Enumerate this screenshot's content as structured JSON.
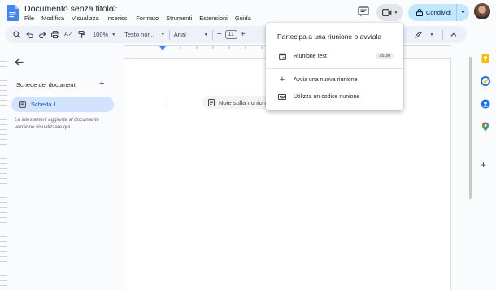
{
  "header": {
    "doc_title": "Documento senza titolo",
    "menu": [
      "File",
      "Modifica",
      "Visualizza",
      "Inserisci",
      "Formato",
      "Strumenti",
      "Estensioni",
      "Guida"
    ],
    "share_label": "Condividi"
  },
  "toolbar": {
    "zoom": "100%",
    "style": "Testo nor...",
    "font": "Arial",
    "font_size": "11"
  },
  "sidebar": {
    "heading": "Schede dei documenti",
    "tab_label": "Scheda 1",
    "note": "Le intestazioni aggiunte al documento verranno visualizzate qui."
  },
  "document": {
    "chip_label": "Note sulla riunione"
  },
  "meet_dropdown": {
    "title": "Partecipa a una riunione o avviala",
    "meeting_name": "Riunione test",
    "meeting_time": "15:30",
    "new_meeting": "Avvia una nuova riunione",
    "use_code": "Utilizza un codice riunione"
  },
  "colors": {
    "accent": "#0b57d0",
    "share_bg": "#c2e7ff",
    "tab_active_bg": "#d3e3fd"
  }
}
